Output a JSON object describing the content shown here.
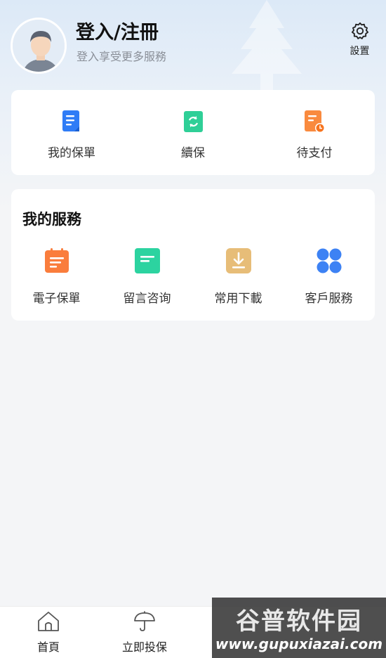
{
  "profile": {
    "title": "登入/注冊",
    "subtitle": "登入享受更多服務",
    "settings_label": "設置"
  },
  "quick_actions": [
    {
      "label": "我的保單",
      "icon": "policy-doc-icon",
      "color": "#2f7cf6"
    },
    {
      "label": "續保",
      "icon": "renew-icon",
      "color": "#2fcf97"
    },
    {
      "label": "待支付",
      "icon": "pending-payment-icon",
      "color": "#f98a3e"
    }
  ],
  "services": {
    "title": "我的服務",
    "items": [
      {
        "label": "電子保單",
        "icon": "e-policy-icon",
        "color": "#fa7d3c"
      },
      {
        "label": "留言咨询",
        "icon": "message-icon",
        "color": "#2cd3a0"
      },
      {
        "label": "常用下載",
        "icon": "download-icon",
        "color": "#e7bd78"
      },
      {
        "label": "客戶服務",
        "icon": "customer-service-icon",
        "color": "#3d82f4"
      }
    ]
  },
  "tabbar": [
    {
      "label": "首頁",
      "icon": "home-icon"
    },
    {
      "label": "立即投保",
      "icon": "umbrella-icon"
    }
  ],
  "watermark": {
    "line1": "谷普软件园",
    "line2": "www.gupuxiazai.com"
  }
}
